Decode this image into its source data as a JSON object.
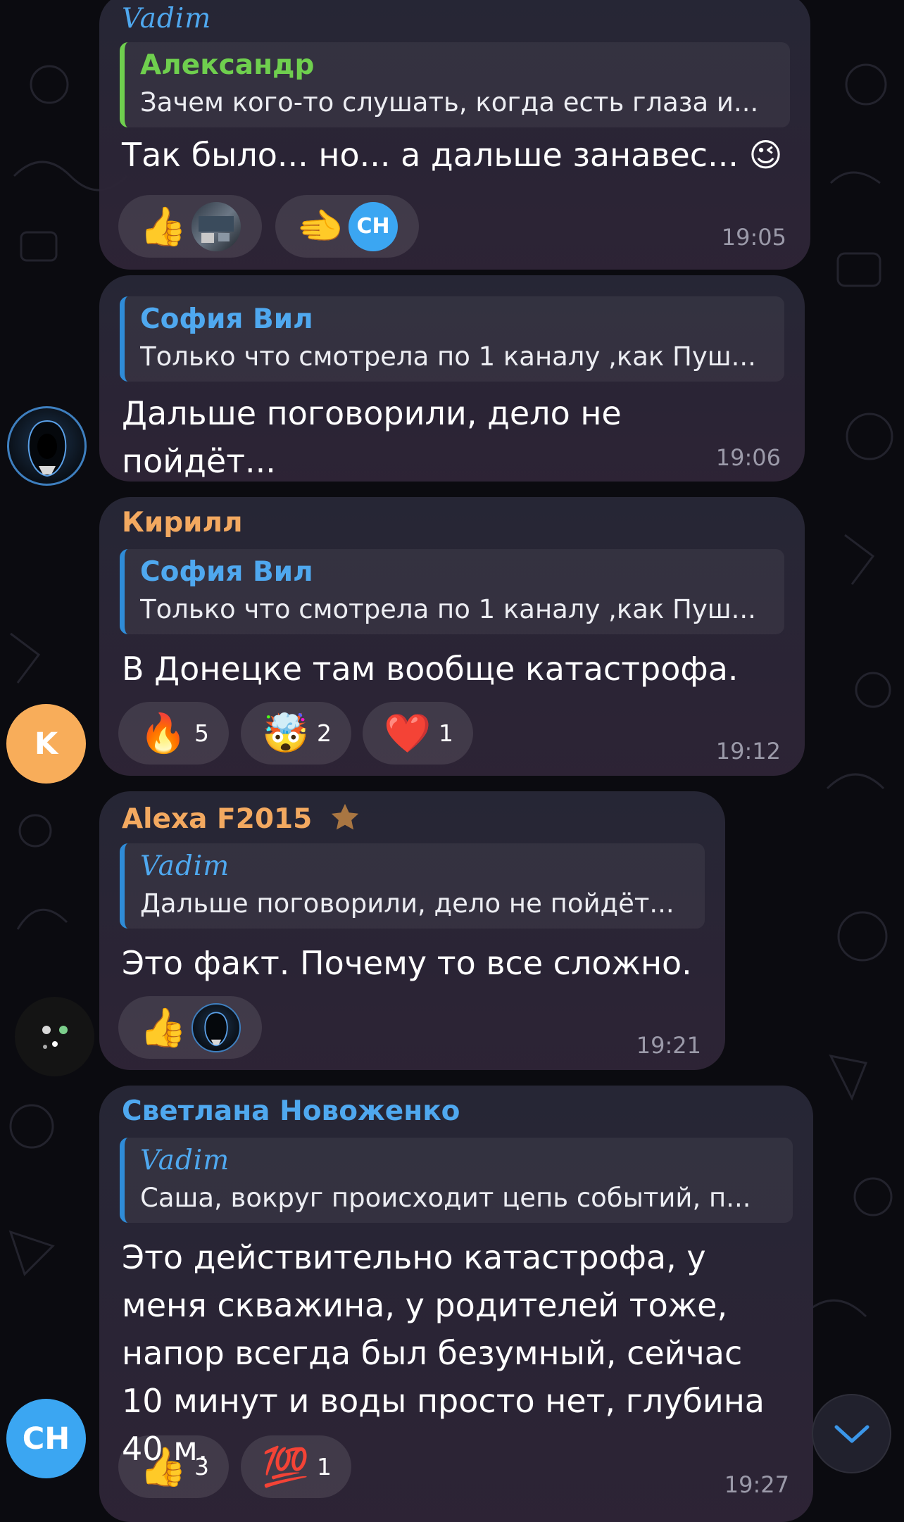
{
  "colors": {
    "background": "#0b0b10",
    "time": "#9b9aa9",
    "quote_bar": "#2f8cd8",
    "name_blue": "#4fa8ef",
    "name_green": "#6fcf4e",
    "name_orange": "#f3a960",
    "avatar_k": "#f8ad5a",
    "avatar_ch": "#3ba6f2"
  },
  "messages": [
    {
      "sender": "Vadim",
      "quote": {
        "name": "Александр",
        "text": "Зачем кого-то слушать, когда есть глаза и..."
      },
      "text": "Так было... но... а дальше занавес... 😉",
      "time": "19:05",
      "reactions": [
        {
          "emoji": "👍",
          "avatar": "photo"
        },
        {
          "emoji": "🫲",
          "avatar": "CH"
        }
      ]
    },
    {
      "quote": {
        "name": "София Вил",
        "text": "Только что смотрела по 1 каналу ,как Пуш..."
      },
      "text": "Дальше поговорили, дело не пойдёт...",
      "time": "19:06"
    },
    {
      "sender": "Кирилл",
      "quote": {
        "name": "София Вил",
        "text": "Только что смотрела по 1 каналу ,как Пуш..."
      },
      "text": "В Донецке там вообще катастрофа.",
      "time": "19:12",
      "reactions": [
        {
          "emoji": "🔥",
          "count": "5"
        },
        {
          "emoji": "🤯",
          "count": "2"
        },
        {
          "emoji": "❤️",
          "count": "1"
        }
      ]
    },
    {
      "sender": "Alexa F2015",
      "quote": {
        "name": "Vadim",
        "text": "Дальше поговорили, дело не пойдёт..."
      },
      "text": "Это факт. Почему то все сложно.",
      "time": "19:21",
      "reactions": [
        {
          "emoji": "👍",
          "avatar": "hooded"
        }
      ]
    },
    {
      "sender": "Светлана Новоженко",
      "quote": {
        "name": "Vadim",
        "text": "Саша, вокруг происходит цепь событий, п..."
      },
      "text": "Это действительно катастрофа, у меня скважина, у родителей тоже, напор всегда был безумный, сейчас 10 минут и воды просто нет, глубина 40 м.",
      "time": "19:27",
      "reactions": [
        {
          "emoji": "👍",
          "count": "3"
        },
        {
          "emoji": "💯",
          "count": "1"
        }
      ]
    }
  ],
  "avatars": {
    "kirill": "K",
    "svetlana": "CH"
  },
  "icons": {
    "admin_badge": "star-icon",
    "scroll_down": "chevron-down-icon"
  }
}
